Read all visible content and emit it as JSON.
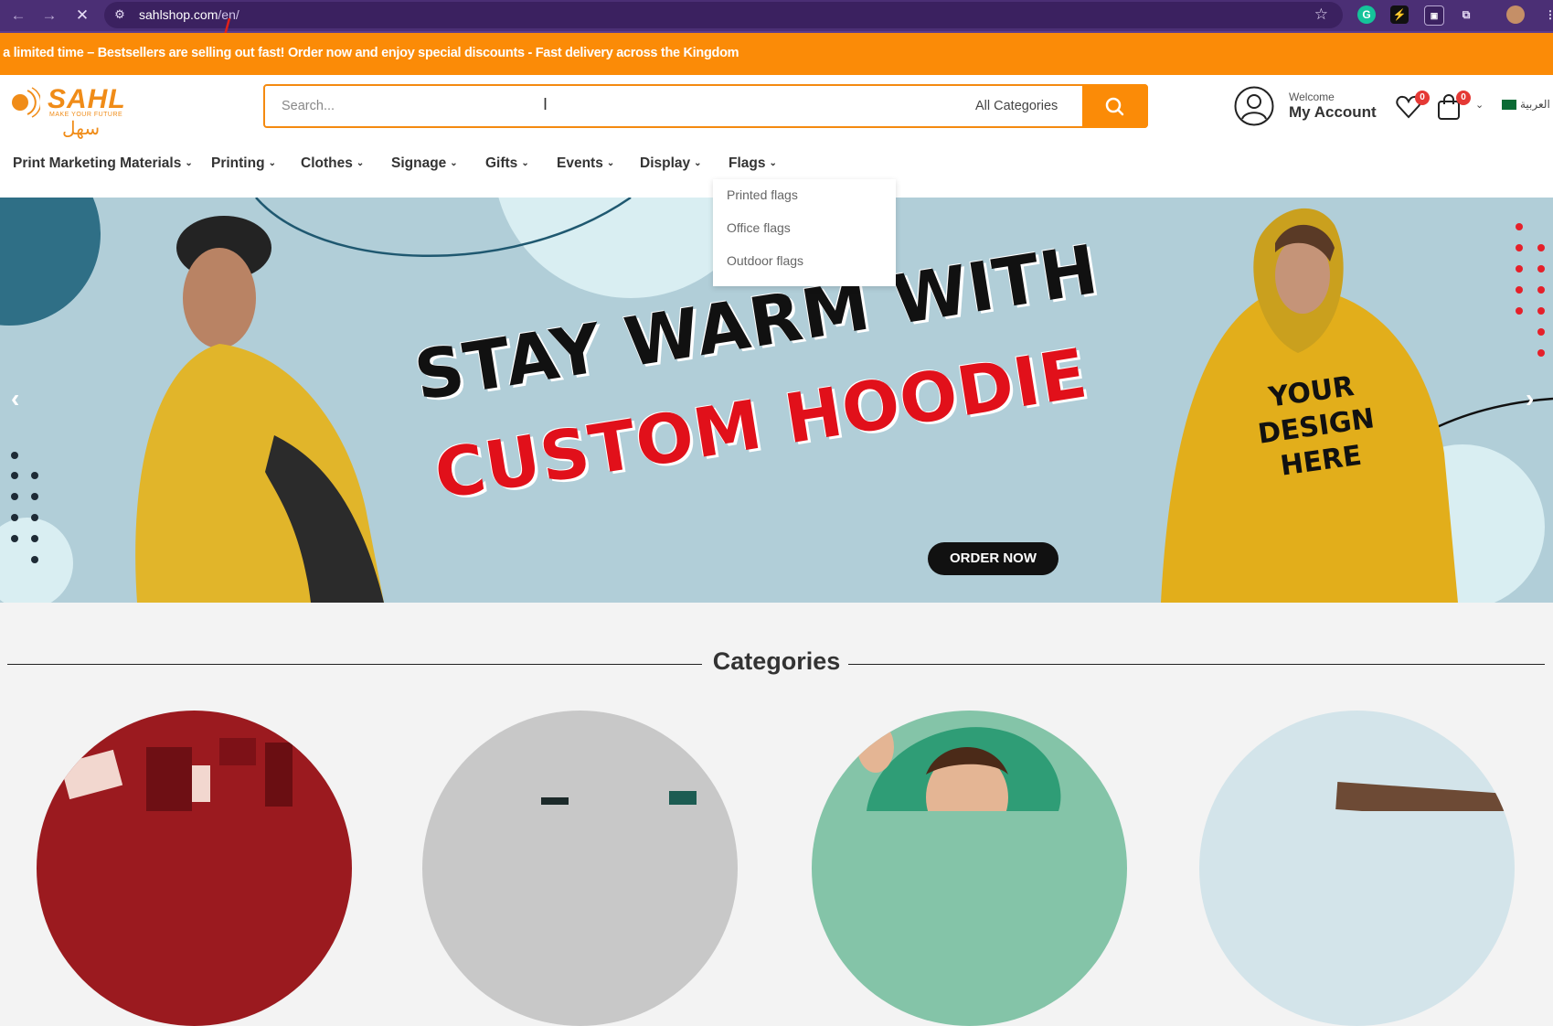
{
  "browser": {
    "url_host": "sahlshop.com",
    "url_path": "/en/"
  },
  "promo": {
    "text": "r a limited time – Bestsellers are selling out fast! Order now and enjoy special discounts - Fast delivery across the Kingdom"
  },
  "logo": {
    "brand": "SAHL",
    "tagline": "MAKE YOUR FUTURE",
    "arabic": "سهل"
  },
  "search": {
    "placeholder": "Search...",
    "category": "All Categories"
  },
  "account": {
    "welcome": "Welcome",
    "label": "My Account"
  },
  "wishlist": {
    "count": "0"
  },
  "cart": {
    "count": "0"
  },
  "language": {
    "label": "العربية"
  },
  "nav": {
    "items": [
      {
        "label": "Print Marketing Materials"
      },
      {
        "label": "Printing"
      },
      {
        "label": "Clothes"
      },
      {
        "label": "Signage"
      },
      {
        "label": "Gifts"
      },
      {
        "label": "Events"
      },
      {
        "label": "Display"
      },
      {
        "label": "Flags"
      }
    ],
    "dropdown": [
      "Printed flags",
      "Office flags",
      "Outdoor flags"
    ]
  },
  "hero": {
    "line1": "STAY WARM WITH",
    "line2": "CUSTOM HOODIE",
    "button": "ORDER NOW",
    "shirt_text": "YOUR DESIGN HERE"
  },
  "categories": {
    "title": "Categories"
  },
  "colors": {
    "accent": "#fb8b07",
    "browser": "#4b2f75",
    "hero_bg": "#b1ced8"
  }
}
